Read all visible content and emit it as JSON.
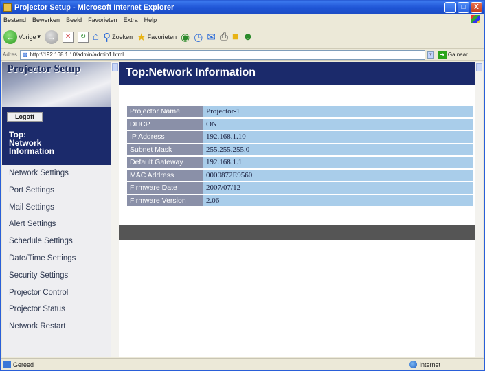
{
  "window": {
    "title": "Projector Setup - Microsoft Internet Explorer",
    "controls": [
      "_",
      "□",
      "X"
    ]
  },
  "menu": [
    "Bestand",
    "Bewerken",
    "Beeld",
    "Favorieten",
    "Extra",
    "Help"
  ],
  "toolbar": {
    "back_label": "Vorige",
    "search_label": "Zoeken",
    "favorites_label": "Favorieten"
  },
  "address": {
    "label": "Adres",
    "url": "http://192.168.1.10/admin/admin1.html",
    "go_label": "Ga naar"
  },
  "sidebar": {
    "logo": "Projector Setup",
    "logoff_label": "Logoff",
    "current_section": [
      "Top:",
      "Network",
      "Information"
    ],
    "nav_items": [
      "Network Settings",
      "Port Settings",
      "Mail Settings",
      "Alert Settings",
      "Schedule Settings",
      "Date/Time Settings",
      "Security Settings",
      "Projector Control",
      "Projector Status",
      "Network Restart"
    ]
  },
  "main": {
    "title": "Top:Network Information",
    "info": [
      {
        "label": "Projector Name",
        "value": "Projector-1"
      },
      {
        "label": "DHCP",
        "value": "ON"
      },
      {
        "label": "IP Address",
        "value": "192.168.1.10"
      },
      {
        "label": "Subnet Mask",
        "value": "255.255.255.0"
      },
      {
        "label": "Default Gateway",
        "value": "192.168.1.1"
      },
      {
        "label": "MAC Address",
        "value": "0000872E9560"
      },
      {
        "label": "Firmware Date",
        "value": "2007/07/12"
      },
      {
        "label": "Firmware Version",
        "value": "2.06"
      }
    ]
  },
  "status": {
    "left": "Gereed",
    "zone": "Internet"
  },
  "colors": {
    "header_navy": "#1b2a6b",
    "label_cell": "#8a90a8",
    "value_cell": "#a9cdea",
    "sidebar_bg": "#eeeef1",
    "footer_bar": "#555555"
  }
}
